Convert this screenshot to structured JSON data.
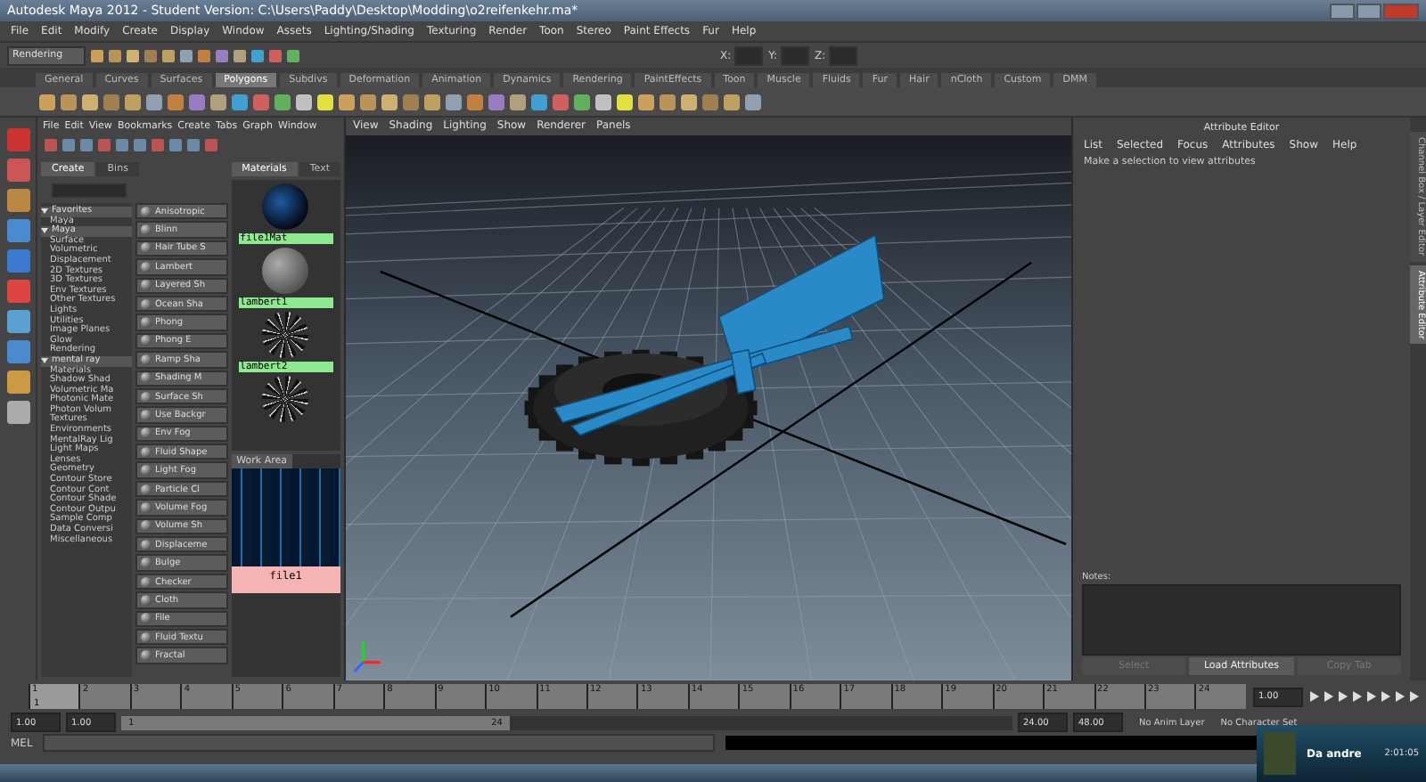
{
  "window": {
    "title": "Autodesk Maya 2012 - Student Version: C:\\Users\\Paddy\\Desktop\\Modding\\o2reifenkehr.ma*"
  },
  "menu_bar": [
    "File",
    "Edit",
    "Modify",
    "Create",
    "Display",
    "Window",
    "Assets",
    "Lighting/Shading",
    "Texturing",
    "Render",
    "Toon",
    "Stereo",
    "Paint Effects",
    "Fur",
    "Help"
  ],
  "status_line": {
    "menu_set": "Rendering",
    "fields": [
      {
        "label": "X:"
      },
      {
        "label": "Y:"
      },
      {
        "label": "Z:"
      }
    ]
  },
  "shelf_tabs": [
    {
      "label": "General",
      "selected": false
    },
    {
      "label": "Curves",
      "selected": false
    },
    {
      "label": "Surfaces",
      "selected": false
    },
    {
      "label": "Polygons",
      "selected": true
    },
    {
      "label": "Subdivs",
      "selected": false
    },
    {
      "label": "Deformation",
      "selected": false
    },
    {
      "label": "Animation",
      "selected": false
    },
    {
      "label": "Dynamics",
      "selected": false
    },
    {
      "label": "Rendering",
      "selected": false
    },
    {
      "label": "PaintEffects",
      "selected": false
    },
    {
      "label": "Toon",
      "selected": false
    },
    {
      "label": "Muscle",
      "selected": false
    },
    {
      "label": "Fluids",
      "selected": false
    },
    {
      "label": "Fur",
      "selected": false
    },
    {
      "label": "Hair",
      "selected": false
    },
    {
      "label": "nCloth",
      "selected": false
    },
    {
      "label": "Custom",
      "selected": false
    },
    {
      "label": "DMM",
      "selected": false
    }
  ],
  "hypershade": {
    "menu": [
      "File",
      "Edit",
      "View",
      "Bookmarks",
      "Create",
      "Tabs",
      "Graph",
      "Window"
    ],
    "tabs": [
      {
        "label": "Create",
        "selected": true
      },
      {
        "label": "Bins",
        "selected": false
      }
    ],
    "tree": [
      {
        "label": "Favorites",
        "expanded": true,
        "children": [
          {
            "label": "Maya"
          }
        ]
      },
      {
        "label": "Maya",
        "expanded": true,
        "children": [
          {
            "label": "Surface"
          },
          {
            "label": "Volumetric"
          },
          {
            "label": "Displacement"
          },
          {
            "label": "2D Textures"
          },
          {
            "label": "3D Textures"
          },
          {
            "label": "Env Textures"
          },
          {
            "label": "Other Textures"
          },
          {
            "label": "Lights"
          },
          {
            "label": "Utilities"
          },
          {
            "label": "Image Planes"
          },
          {
            "label": "Glow"
          },
          {
            "label": "Rendering"
          }
        ]
      },
      {
        "label": "mental ray",
        "expanded": true,
        "children": [
          {
            "label": "Materials"
          },
          {
            "label": "Shadow Shad"
          },
          {
            "label": "Volumetric Ma"
          },
          {
            "label": "Photonic Mate"
          },
          {
            "label": "Photon Volum"
          },
          {
            "label": "Textures"
          },
          {
            "label": "Environments"
          },
          {
            "label": "MentalRay Lig"
          },
          {
            "label": "Light Maps"
          },
          {
            "label": "Lenses"
          },
          {
            "label": "Geometry"
          },
          {
            "label": "Contour Store"
          },
          {
            "label": "Contour Cont"
          },
          {
            "label": "Contour Shade"
          },
          {
            "label": "Contour Outpu"
          },
          {
            "label": "Sample Comp"
          },
          {
            "label": "Data Conversi"
          },
          {
            "label": "Miscellaneous"
          }
        ]
      }
    ],
    "nodes": [
      "Anisotropic",
      "Blinn",
      "Hair Tube S",
      "Lambert",
      "Layered Sh",
      "Ocean Sha",
      "Phong",
      "Phong E",
      "Ramp Sha",
      "Shading M",
      "Surface Sh",
      "Use Backgr",
      "Env Fog",
      "Fluid Shape",
      "Light Fog",
      "Particle Cl",
      "Volume Fog",
      "Volume Sh",
      "Displaceme",
      "Bulge",
      "Checker",
      "Cloth",
      "File",
      "Fluid Textu",
      "Fractal"
    ],
    "material_tabs": [
      {
        "label": "Materials",
        "selected": true
      },
      {
        "label": "Text",
        "selected": false
      }
    ],
    "swatches": [
      {
        "label": "file1Mat",
        "kind": "texture"
      },
      {
        "label": "lambert1",
        "kind": "plain"
      },
      {
        "label": "lambert2",
        "kind": "noise"
      },
      {
        "kind": "noise"
      }
    ],
    "work_area": {
      "title": "Work Area",
      "node": "file1"
    }
  },
  "viewport": {
    "menu": [
      "View",
      "Shading",
      "Lighting",
      "Show",
      "Renderer",
      "Panels"
    ]
  },
  "attribute_editor": {
    "title": "Attribute Editor",
    "menu": [
      "List",
      "Selected",
      "Focus",
      "Attributes",
      "Show",
      "Help"
    ],
    "message": "Make a selection to view attributes",
    "notes_label": "Notes:",
    "buttons": [
      {
        "label": "Select",
        "disabled": true
      },
      {
        "label": "Load Attributes",
        "disabled": false
      },
      {
        "label": "Copy Tab",
        "disabled": true
      }
    ]
  },
  "side_tabs": [
    {
      "label": "Channel Box / Layer Editor",
      "selected": false
    },
    {
      "label": "Attribute Editor",
      "selected": true
    }
  ],
  "timeline": {
    "frames": [
      {
        "label": "1",
        "selected": true
      },
      {
        "label": "2",
        "selected": false
      },
      {
        "label": "3",
        "selected": false
      },
      {
        "label": "4",
        "selected": false
      },
      {
        "label": "5",
        "selected": false
      },
      {
        "label": "6",
        "selected": false
      },
      {
        "label": "7",
        "selected": false
      },
      {
        "label": "8",
        "selected": false
      },
      {
        "label": "9",
        "selected": false
      },
      {
        "label": "10",
        "selected": false
      },
      {
        "label": "11",
        "selected": false
      },
      {
        "label": "12",
        "selected": false
      },
      {
        "label": "13",
        "selected": false
      },
      {
        "label": "14",
        "selected": false
      },
      {
        "label": "15",
        "selected": false
      },
      {
        "label": "16",
        "selected": false
      },
      {
        "label": "17",
        "selected": false
      },
      {
        "label": "18",
        "selected": false
      },
      {
        "label": "19",
        "selected": false
      },
      {
        "label": "20",
        "selected": false
      },
      {
        "label": "21",
        "selected": false
      },
      {
        "label": "22",
        "selected": false
      },
      {
        "label": "23",
        "selected": false
      },
      {
        "label": "24",
        "selected": false
      }
    ],
    "current_frame": "1",
    "current_field": "1.00"
  },
  "range": {
    "start": "1.00",
    "playback_start": "1.00",
    "slider_start": "1",
    "slider_end": "24",
    "level": 0.42,
    "playback_end": "24.00",
    "end": "48.00",
    "anim_layer": "No Anim Layer",
    "character_set": "No Character Set"
  },
  "command_line": {
    "label": "MEL"
  },
  "notification": {
    "title": "Da andre",
    "time": "2:01:05"
  }
}
